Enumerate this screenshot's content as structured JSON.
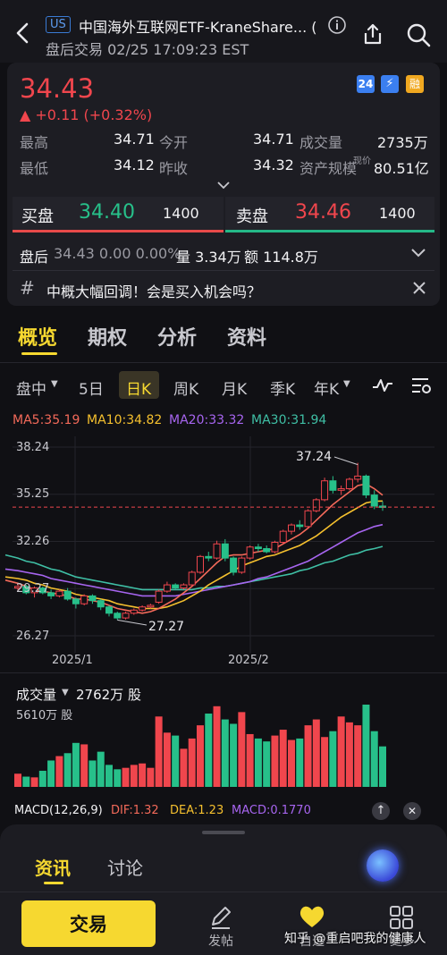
{
  "header": {
    "market_badge": "US",
    "title": "中国海外互联网ETF-KraneShare... (",
    "subtitle": "盘后交易 02/25 17:09:23 EST"
  },
  "quote": {
    "price": "34.43",
    "change": "▲ +0.11 (+0.32%)",
    "badges": [
      "24",
      "⚡",
      "融"
    ],
    "stats": {
      "high_label": "最高",
      "high": "34.71",
      "open_label": "今开",
      "open": "34.71",
      "volume_label": "成交量",
      "volume": "2735万",
      "low_label": "最低",
      "low": "34.12",
      "prev_close_label": "昨收",
      "prev_close": "34.32",
      "aum_label": "资产规模",
      "aum_note": "现价",
      "aum": "80.51亿"
    },
    "bid": {
      "label": "买盘",
      "price": "34.40",
      "size": "1400"
    },
    "ask": {
      "label": "卖盘",
      "price": "34.46",
      "size": "1400"
    },
    "after_hours": {
      "label": "盘后",
      "text": "34.43 0.00 0.00%",
      "volume": "量 3.34万",
      "amount": "额 114.8万"
    },
    "news_banner": "中概大幅回调！会是买入机会吗？"
  },
  "tabs": [
    "概览",
    "期权",
    "分析",
    "资料"
  ],
  "kline_tabs": [
    "盘中",
    "5日",
    "日K",
    "周K",
    "月K",
    "季K",
    "年K"
  ],
  "ma_legend": {
    "ma5": "MA5:35.19",
    "ma10": "MA10:34.82",
    "ma20": "MA20:33.32",
    "ma30": "MA30:31.94"
  },
  "colors": {
    "up": "#f0464d",
    "down": "#27c08a",
    "ma5": "#f46a5a",
    "ma10": "#f5c02e",
    "ma20": "#a765f0",
    "ma30": "#3fbfa5",
    "accent": "#f6d830"
  },
  "chart_data": {
    "type": "candlestick",
    "y_ticks": [
      "38.24",
      "35.25",
      "32.26",
      "29.27",
      "26.27"
    ],
    "ylim": [
      26.27,
      38.24
    ],
    "x_labels": [
      "2025/1",
      "2025/2"
    ],
    "annotations": {
      "high": "37.24",
      "low": "27.27"
    },
    "last_price_line": 34.43,
    "candles": [
      [
        29.3,
        29.6,
        29.1,
        29.4
      ],
      [
        29.4,
        29.5,
        28.9,
        29.0
      ],
      [
        29.0,
        29.4,
        28.7,
        29.3
      ],
      [
        29.3,
        29.4,
        28.9,
        29.0
      ],
      [
        29.0,
        29.2,
        28.6,
        28.8
      ],
      [
        28.8,
        29.2,
        28.7,
        29.1
      ],
      [
        29.1,
        29.3,
        28.5,
        28.6
      ],
      [
        28.6,
        28.7,
        28.0,
        28.3
      ],
      [
        28.3,
        28.9,
        28.2,
        28.8
      ],
      [
        28.8,
        28.9,
        28.3,
        28.5
      ],
      [
        28.5,
        28.6,
        27.9,
        28.1
      ],
      [
        28.1,
        28.2,
        27.5,
        27.7
      ],
      [
        27.7,
        27.8,
        27.27,
        27.4
      ],
      [
        27.4,
        27.8,
        27.3,
        27.7
      ],
      [
        27.7,
        28.0,
        27.6,
        27.9
      ],
      [
        27.9,
        28.2,
        27.8,
        28.1
      ],
      [
        28.1,
        28.3,
        28.0,
        28.2
      ],
      [
        28.4,
        29.2,
        28.3,
        29.1
      ],
      [
        29.1,
        29.7,
        29.0,
        29.5
      ],
      [
        29.5,
        29.6,
        29.2,
        29.3
      ],
      [
        29.3,
        29.6,
        29.2,
        29.5
      ],
      [
        29.5,
        30.4,
        29.4,
        30.3
      ],
      [
        30.3,
        31.4,
        30.2,
        31.3
      ],
      [
        31.3,
        31.6,
        31.0,
        31.2
      ],
      [
        31.2,
        32.3,
        31.1,
        32.1
      ],
      [
        32.1,
        32.4,
        31.0,
        31.2
      ],
      [
        31.2,
        31.3,
        30.1,
        30.3
      ],
      [
        30.3,
        31.3,
        30.2,
        31.2
      ],
      [
        31.2,
        32.0,
        31.1,
        31.9
      ],
      [
        31.9,
        32.1,
        31.6,
        31.8
      ],
      [
        31.8,
        32.0,
        31.5,
        31.6
      ],
      [
        31.6,
        32.3,
        31.5,
        32.2
      ],
      [
        32.2,
        33.0,
        32.1,
        32.9
      ],
      [
        32.9,
        33.4,
        32.7,
        33.3
      ],
      [
        33.3,
        33.6,
        33.0,
        33.2
      ],
      [
        33.2,
        34.3,
        33.1,
        34.2
      ],
      [
        34.2,
        35.0,
        34.1,
        34.9
      ],
      [
        34.9,
        36.3,
        34.8,
        36.1
      ],
      [
        36.1,
        36.4,
        35.3,
        35.5
      ],
      [
        35.5,
        35.8,
        35.2,
        35.6
      ],
      [
        35.6,
        36.3,
        35.5,
        36.2
      ],
      [
        36.2,
        37.24,
        36.0,
        36.4
      ],
      [
        36.4,
        36.5,
        35.0,
        35.2
      ],
      [
        35.2,
        35.5,
        34.3,
        34.5
      ],
      [
        34.5,
        34.8,
        34.2,
        34.43
      ]
    ],
    "ma5": [
      29.6,
      29.4,
      29.2,
      29.1,
      29.0,
      28.9,
      28.8,
      28.6,
      28.6,
      28.5,
      28.4,
      28.2,
      28.0,
      27.9,
      27.8,
      27.7,
      27.8,
      28.0,
      28.3,
      28.6,
      29.0,
      29.4,
      29.9,
      30.4,
      30.9,
      31.3,
      31.4,
      31.4,
      31.5,
      31.6,
      31.7,
      31.8,
      32.1,
      32.4,
      32.7,
      33.1,
      33.6,
      34.1,
      34.6,
      35.0,
      35.4,
      35.8,
      35.9,
      35.6,
      35.19
    ],
    "ma10": [
      29.9,
      29.8,
      29.6,
      29.5,
      29.3,
      29.2,
      29.1,
      28.9,
      28.8,
      28.7,
      28.6,
      28.5,
      28.3,
      28.2,
      28.1,
      28.0,
      28.0,
      28.0,
      28.1,
      28.3,
      28.5,
      28.8,
      29.1,
      29.5,
      29.8,
      30.1,
      30.4,
      30.7,
      30.9,
      31.1,
      31.3,
      31.4,
      31.6,
      31.8,
      32.0,
      32.3,
      32.6,
      33.0,
      33.4,
      33.8,
      34.1,
      34.4,
      34.7,
      34.8,
      34.82
    ],
    "ma20": [
      30.4,
      30.3,
      30.2,
      30.1,
      29.9,
      29.8,
      29.7,
      29.6,
      29.5,
      29.4,
      29.3,
      29.2,
      29.1,
      29.0,
      28.9,
      28.8,
      28.8,
      28.8,
      28.8,
      28.8,
      28.9,
      29.0,
      29.1,
      29.2,
      29.3,
      29.4,
      29.5,
      29.6,
      29.7,
      29.9,
      30.0,
      30.2,
      30.4,
      30.6,
      30.8,
      31.0,
      31.3,
      31.6,
      31.9,
      32.2,
      32.5,
      32.8,
      33.0,
      33.2,
      33.32
    ],
    "ma30": [
      31.2,
      31.0,
      30.9,
      30.7,
      30.5,
      30.4,
      30.2,
      30.0,
      29.9,
      29.8,
      29.7,
      29.6,
      29.5,
      29.4,
      29.3,
      29.2,
      29.2,
      29.2,
      29.2,
      29.2,
      29.2,
      29.2,
      29.3,
      29.3,
      29.4,
      29.4,
      29.5,
      29.6,
      29.7,
      29.8,
      29.9,
      30.0,
      30.1,
      30.2,
      30.4,
      30.5,
      30.7,
      30.9,
      31.0,
      31.2,
      31.4,
      31.5,
      31.7,
      31.8,
      31.94
    ]
  },
  "volume": {
    "label": "成交量",
    "value": "2762万 股",
    "max_label": "5610万 股",
    "max": 5610,
    "bars": [
      900,
      700,
      650,
      1100,
      1800,
      2100,
      2300,
      3000,
      2900,
      1800,
      2400,
      1500,
      1200,
      1300,
      1500,
      1600,
      1300,
      4800,
      3700,
      3500,
      2600,
      3300,
      4200,
      5000,
      5500,
      4600,
      4300,
      5100,
      3600,
      3300,
      3100,
      3500,
      3900,
      3200,
      3300,
      4200,
      4600,
      3400,
      3800,
      4800,
      4400,
      4200,
      5900,
      3800,
      2762
    ]
  },
  "macd": {
    "title": "MACD(12,26,9)",
    "dif": "DIF:1.32",
    "dea": "DEA:1.23",
    "macd": "MACD:0.1770"
  },
  "bottom": {
    "tabs": [
      "资讯",
      "讨论"
    ],
    "trade_label": "交易",
    "post_label": "发帖",
    "watch_label": "自选",
    "more_label": "更多"
  },
  "watermark": "知乎 @重启吧我的健康人"
}
